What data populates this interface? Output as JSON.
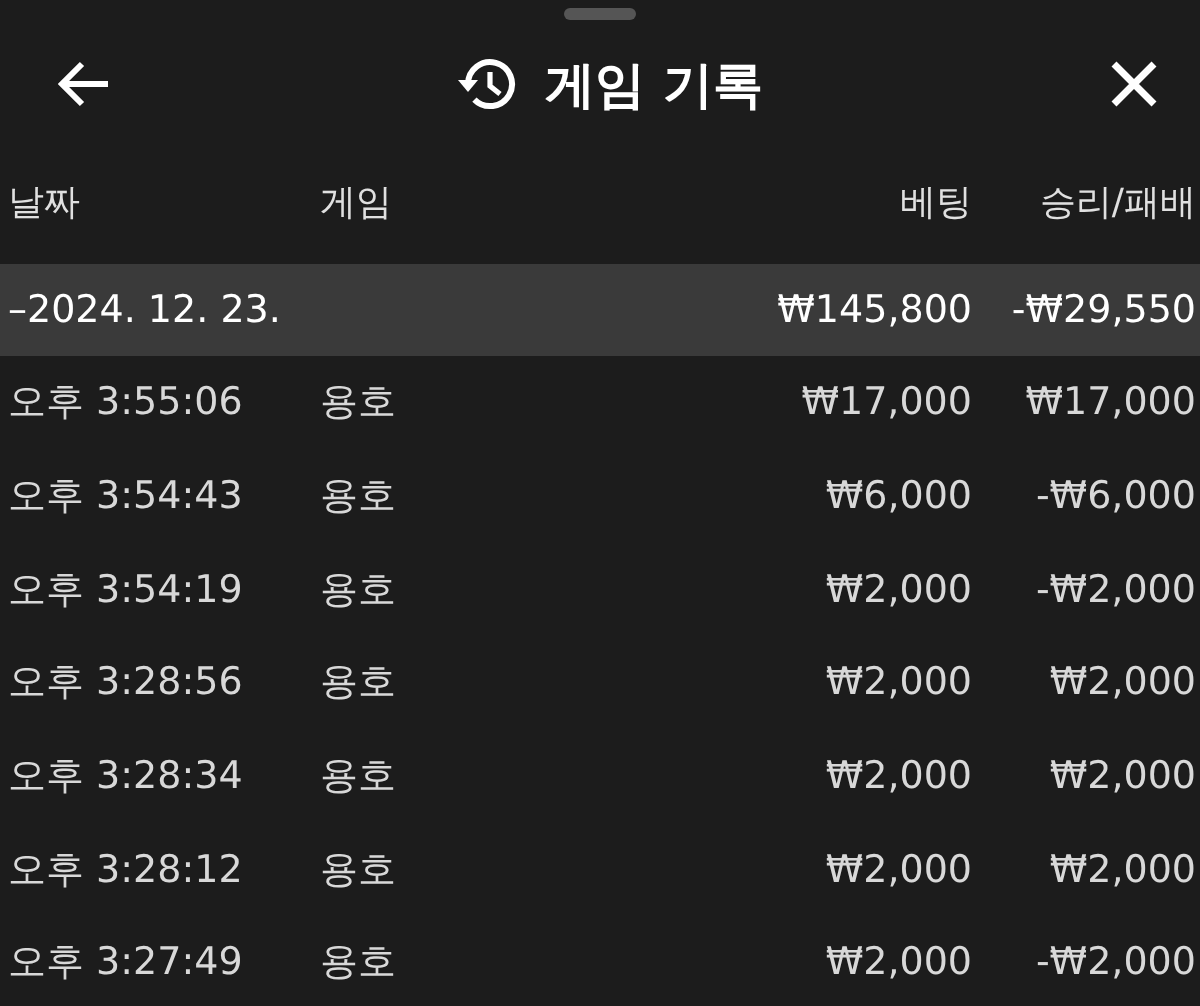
{
  "header": {
    "title": "게임 기록"
  },
  "columns": [
    "날짜",
    "게임",
    "베팅",
    "승리/패배"
  ],
  "groups": [
    {
      "date": "–2024. 12. 23.",
      "bet": "₩145,800",
      "result": "-₩29,550",
      "rows": [
        {
          "time": "오후 3:55:06",
          "game": "용호",
          "bet": "₩17,000",
          "result": "₩17,000"
        },
        {
          "time": "오후 3:54:43",
          "game": "용호",
          "bet": "₩6,000",
          "result": "-₩6,000"
        },
        {
          "time": "오후 3:54:19",
          "game": "용호",
          "bet": "₩2,000",
          "result": "-₩2,000"
        },
        {
          "time": "오후 3:28:56",
          "game": "용호",
          "bet": "₩2,000",
          "result": "₩2,000"
        },
        {
          "time": "오후 3:28:34",
          "game": "용호",
          "bet": "₩2,000",
          "result": "₩2,000"
        },
        {
          "time": "오후 3:28:12",
          "game": "용호",
          "bet": "₩2,000",
          "result": "₩2,000"
        },
        {
          "time": "오후 3:27:49",
          "game": "용호",
          "bet": "₩2,000",
          "result": "-₩2,000"
        }
      ]
    }
  ]
}
